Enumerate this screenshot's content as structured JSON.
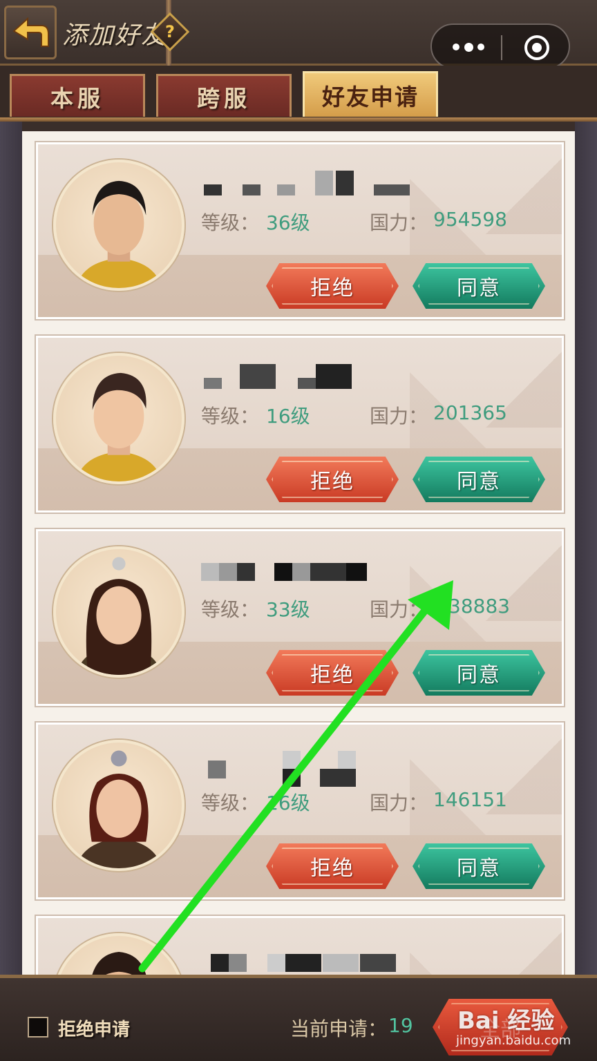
{
  "header": {
    "title": "添加好友",
    "help_glyph": "?",
    "back_icon": "back-arrow-icon",
    "capsule": {
      "more_icon": "more-dots-icon",
      "close_icon": "target-close-icon"
    }
  },
  "tabs": [
    {
      "label": "本服",
      "active": false
    },
    {
      "label": "跨服",
      "active": false
    },
    {
      "label": "好友申请",
      "active": true
    }
  ],
  "requests": [
    {
      "level_label": "等级：",
      "level": "36级",
      "power_label": "国力：",
      "power": "954598",
      "reject_label": "拒绝",
      "agree_label": "同意"
    },
    {
      "level_label": "等级：",
      "level": "16级",
      "power_label": "国力：",
      "power": "201365",
      "reject_label": "拒绝",
      "agree_label": "同意"
    },
    {
      "level_label": "等级：",
      "level": "33级",
      "power_label": "国力：",
      "power": "38883",
      "reject_label": "拒绝",
      "agree_label": "同意"
    },
    {
      "level_label": "等级：",
      "level": "16级",
      "power_label": "国力：",
      "power": "146151",
      "reject_label": "拒绝",
      "agree_label": "同意"
    }
  ],
  "footer": {
    "reject_checkbox_label": "拒绝申请",
    "checked": false,
    "current_label": "当前申请：",
    "current_count": "19",
    "action_button": "全部"
  },
  "watermark": {
    "logo": "Bai 经验",
    "url": "jingyan.baidu.com"
  },
  "colors": {
    "reject": "#d9452c",
    "agree": "#1f9a76",
    "accent_stat": "#3f9c7e",
    "annotation_arrow": "#22e022"
  }
}
